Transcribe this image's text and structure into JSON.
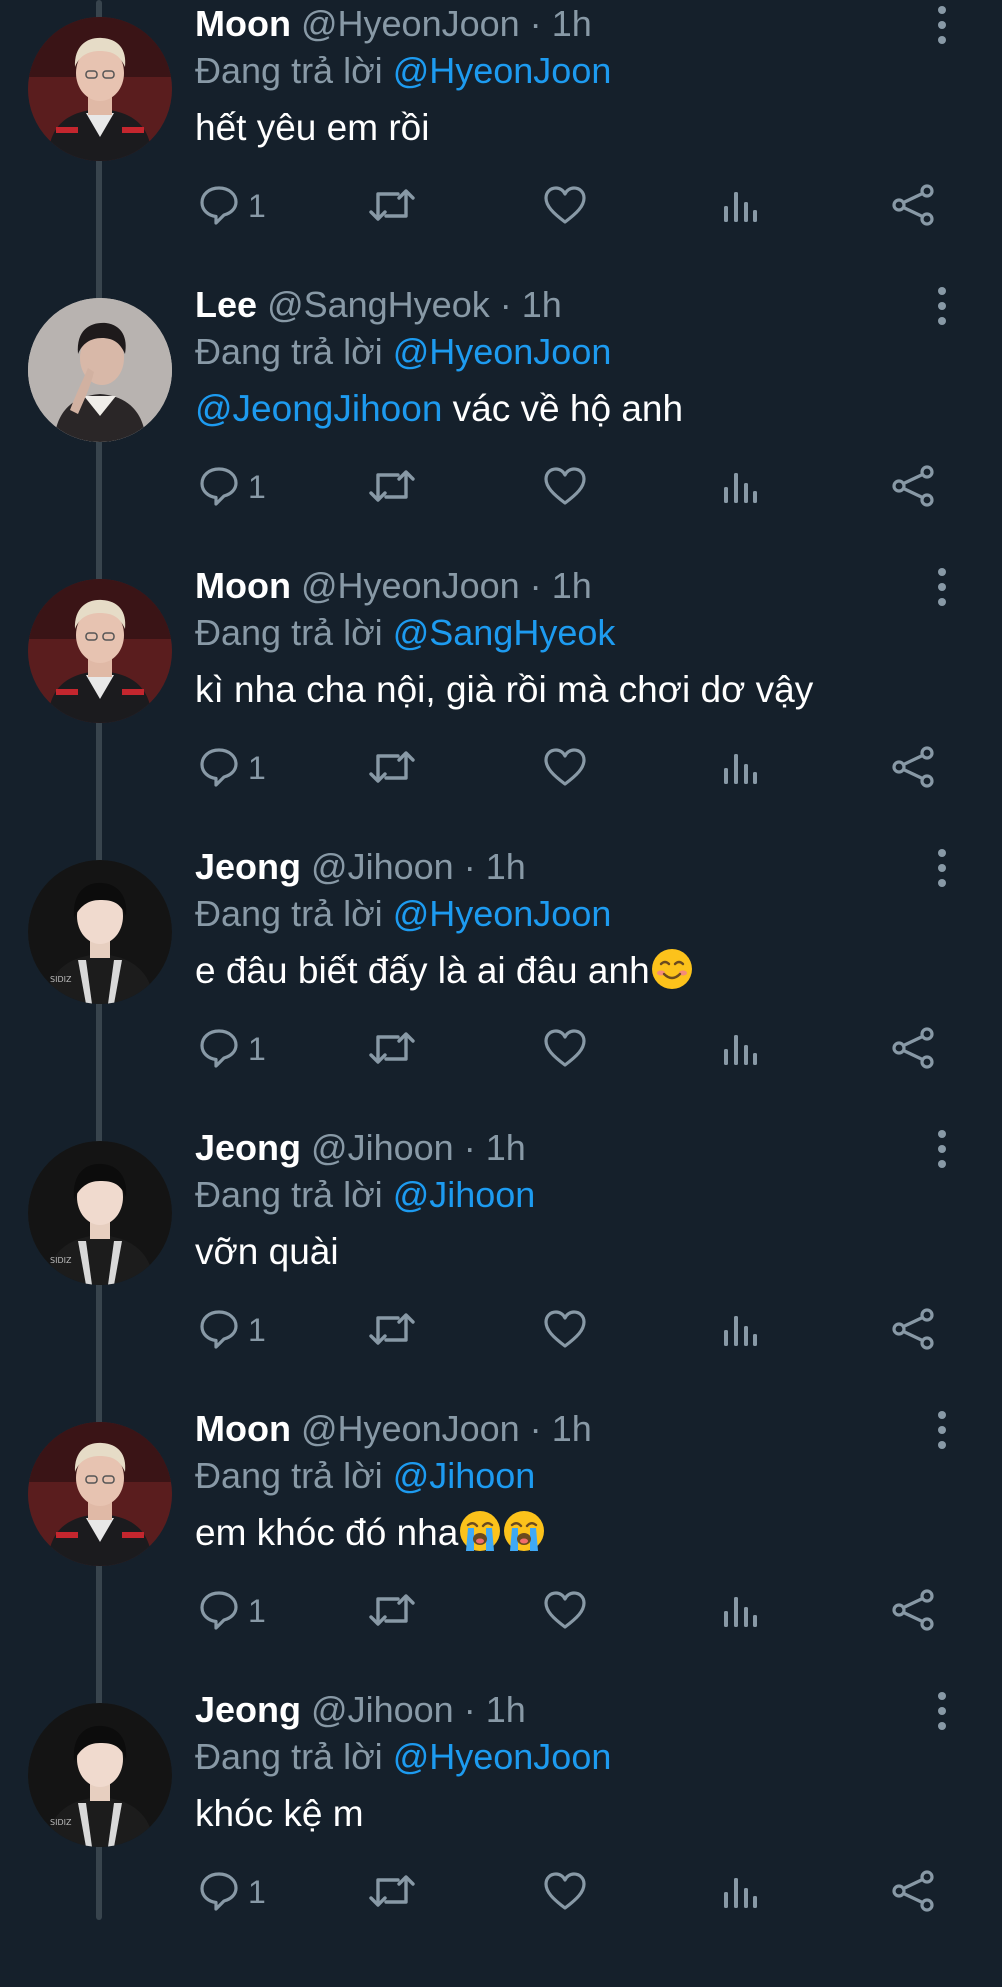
{
  "tweets": [
    {
      "name": "Moon",
      "handle": "@HyeonJoon",
      "time": "1h",
      "reply_prefix": "Đang trả lời",
      "reply_to": "@HyeonJoon",
      "text_mention": "",
      "text": "hết yêu em rồi",
      "emojis": [],
      "reply_count": "1",
      "avatar": "moon"
    },
    {
      "name": "Lee",
      "handle": "@SangHyeok",
      "time": "1h",
      "reply_prefix": "Đang trả lời",
      "reply_to": "@HyeonJoon",
      "text_mention": "@JeongJihoon",
      "text": " vác về hộ anh",
      "emojis": [],
      "reply_count": "1",
      "avatar": "lee"
    },
    {
      "name": "Moon",
      "handle": "@HyeonJoon",
      "time": "1h",
      "reply_prefix": "Đang trả lời",
      "reply_to": "@SangHyeok",
      "text_mention": "",
      "text": "kì nha cha nội, già rồi mà chơi dơ vậy",
      "emojis": [],
      "reply_count": "1",
      "avatar": "moon"
    },
    {
      "name": "Jeong",
      "handle": "@Jihoon",
      "time": "1h",
      "reply_prefix": "Đang trả lời",
      "reply_to": "@HyeonJoon",
      "text_mention": "",
      "text": "e đâu biết đấy là ai đâu anh",
      "emojis": [
        "smiling-face-emoji"
      ],
      "reply_count": "1",
      "avatar": "jeong"
    },
    {
      "name": "Jeong",
      "handle": "@Jihoon",
      "time": "1h",
      "reply_prefix": "Đang trả lời",
      "reply_to": "@Jihoon",
      "text_mention": "",
      "text": "vỡn quài",
      "emojis": [],
      "reply_count": "1",
      "avatar": "jeong"
    },
    {
      "name": "Moon",
      "handle": "@HyeonJoon",
      "time": "1h",
      "reply_prefix": "Đang trả lời",
      "reply_to": "@Jihoon",
      "text_mention": "",
      "text": "em khóc đó nha",
      "emojis": [
        "loudly-crying-face-emoji",
        "loudly-crying-face-emoji"
      ],
      "reply_count": "1",
      "avatar": "moon"
    },
    {
      "name": "Jeong",
      "handle": "@Jihoon",
      "time": "1h",
      "reply_prefix": "Đang trả lời",
      "reply_to": "@HyeonJoon",
      "text_mention": "",
      "text": "khóc kệ m",
      "emojis": [],
      "reply_count": "1",
      "avatar": "jeong"
    }
  ],
  "separator": "·",
  "icons": {
    "reply": "reply-icon",
    "retweet": "retweet-icon",
    "like": "heart-icon",
    "analytics": "analytics-icon",
    "share": "share-icon",
    "more": "more-vertical-icon"
  },
  "colors": {
    "background": "#15202b",
    "text": "#ffffff",
    "secondary": "#8899a6",
    "mention": "#1d9bf0",
    "thread_line": "#38444d"
  }
}
